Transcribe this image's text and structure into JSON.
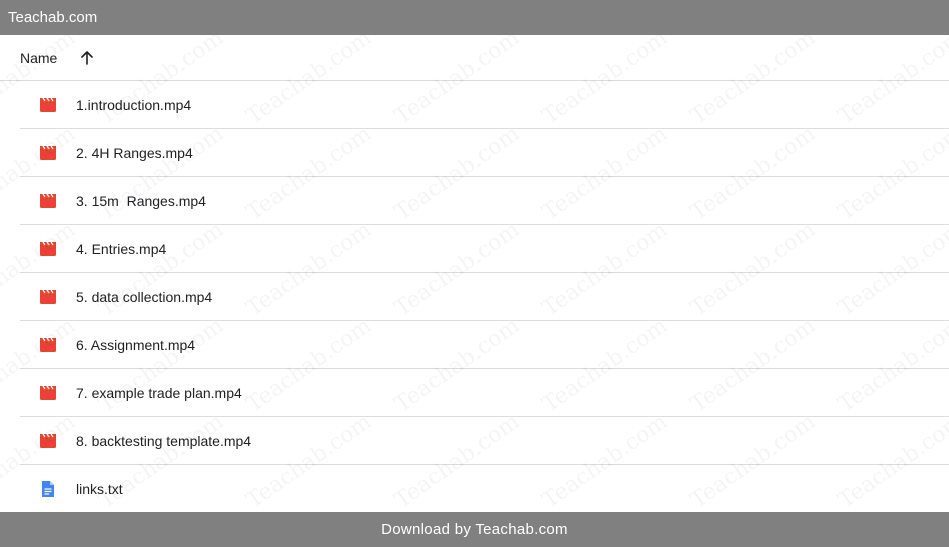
{
  "topbar": {
    "title": "Teachab.com"
  },
  "list": {
    "header": {
      "name_label": "Name",
      "sort_icon": "arrow-up-icon"
    },
    "files": [
      {
        "name": "1.introduction.mp4",
        "type": "video",
        "icon": "video-file-icon",
        "icon_color": "#ea4335"
      },
      {
        "name": "2. 4H Ranges.mp4",
        "type": "video",
        "icon": "video-file-icon",
        "icon_color": "#ea4335"
      },
      {
        "name": "3. 15m  Ranges.mp4",
        "type": "video",
        "icon": "video-file-icon",
        "icon_color": "#ea4335"
      },
      {
        "name": "4. Entries.mp4",
        "type": "video",
        "icon": "video-file-icon",
        "icon_color": "#ea4335"
      },
      {
        "name": "5. data collection.mp4",
        "type": "video",
        "icon": "video-file-icon",
        "icon_color": "#ea4335"
      },
      {
        "name": "6. Assignment.mp4",
        "type": "video",
        "icon": "video-file-icon",
        "icon_color": "#ea4335"
      },
      {
        "name": "7. example trade plan.mp4",
        "type": "video",
        "icon": "video-file-icon",
        "icon_color": "#ea4335"
      },
      {
        "name": "8. backtesting template.mp4",
        "type": "video",
        "icon": "video-file-icon",
        "icon_color": "#ea4335"
      },
      {
        "name": "links.txt",
        "type": "doc",
        "icon": "text-document-icon",
        "icon_color": "#4285f4"
      }
    ]
  },
  "watermark": {
    "text": "Teachab.com"
  },
  "footer": {
    "text": "Download by Teachab.com"
  },
  "colors": {
    "bar_bg": "#808080",
    "divider": "#dadce0"
  }
}
